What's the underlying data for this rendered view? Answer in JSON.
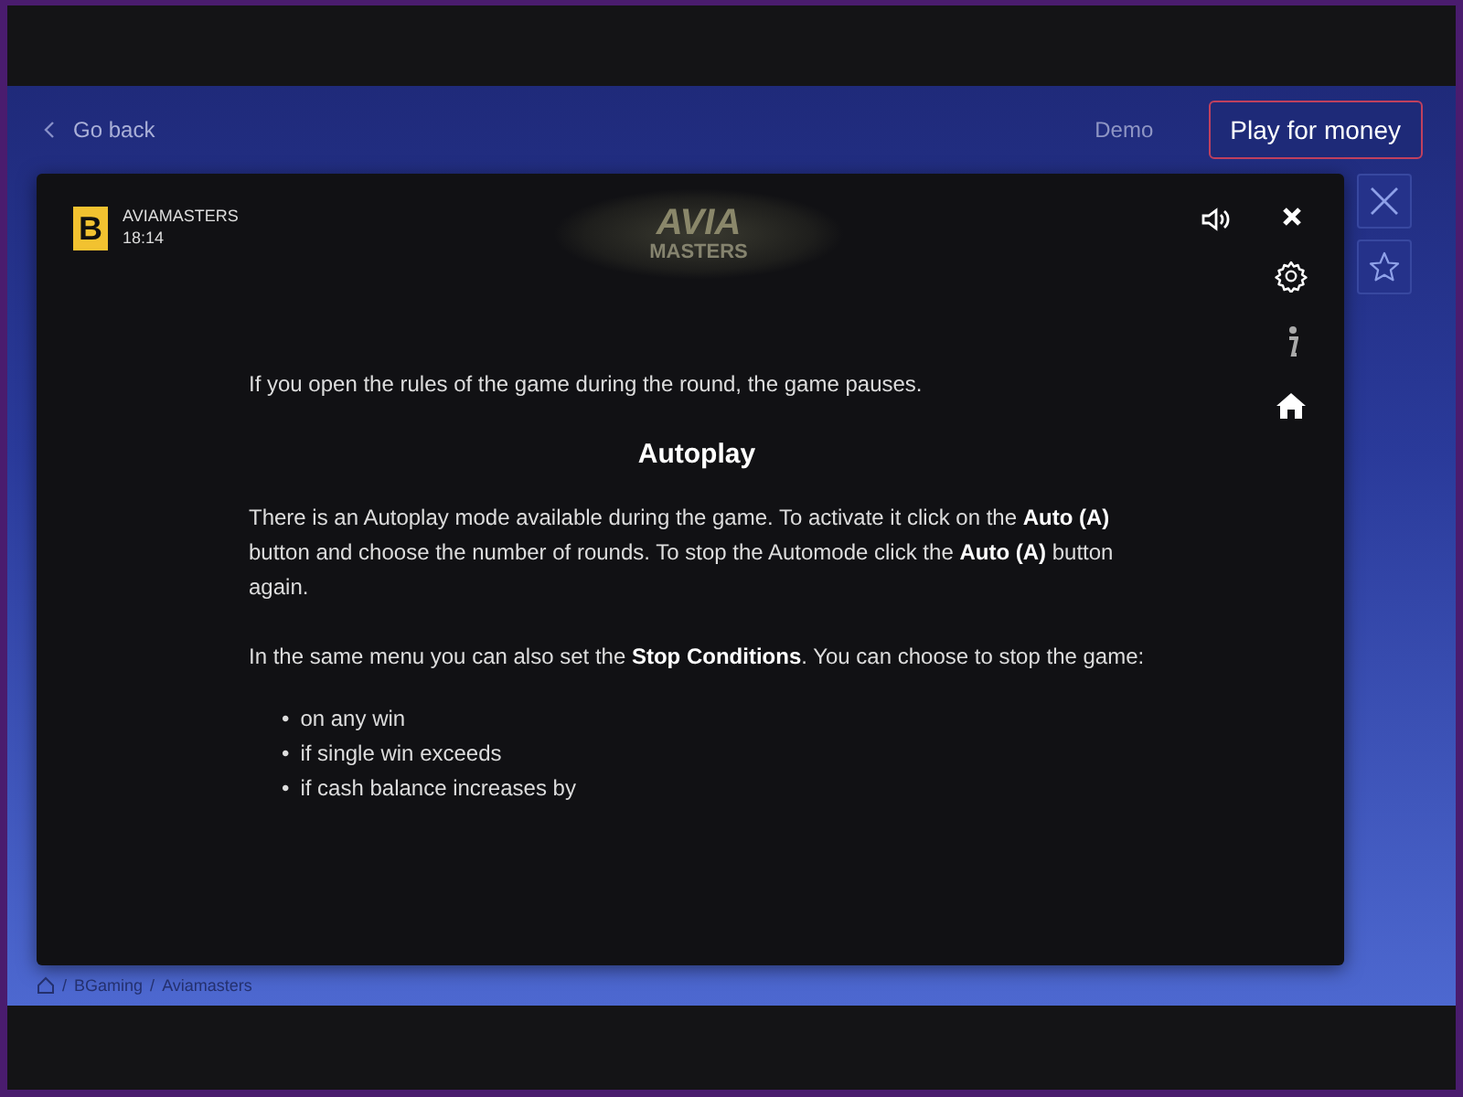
{
  "header": {
    "back": "Go back",
    "demo": "Demo",
    "play": "Play for money"
  },
  "game": {
    "logo_letter": "B",
    "name": "AVIAMASTERS",
    "time": "18:14",
    "logo_top": "AVIA",
    "logo_bottom": "MASTERS"
  },
  "rules": [
    {
      "kind": "paragraph",
      "text": "If you open the rules of the game during the round, the game pauses."
    },
    {
      "kind": "heading",
      "text": "Autoplay"
    },
    {
      "kind": "paragraph",
      "text": "There is an Autoplay mode available during the game. To activate it click on the **Auto (A)** button and choose the number of rounds. To stop the Automode click the **Auto (A)** button again."
    },
    {
      "kind": "paragraph",
      "text": "In the same menu you can also set the **Stop Conditions**. You can choose to stop the game:"
    },
    {
      "kind": "list",
      "marker": "•",
      "items": [
        "on any win",
        "if single win exceeds",
        "if cash balance increases by"
      ]
    }
  ],
  "breadcrumb": {
    "separator": "/",
    "items": [
      "BGaming",
      "Aviamasters"
    ]
  }
}
